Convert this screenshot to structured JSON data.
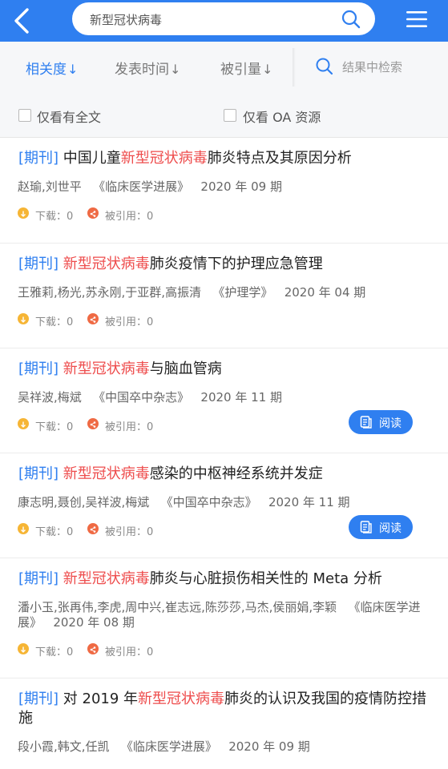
{
  "header": {
    "search_query": "新型冠状病毒"
  },
  "sort": {
    "relevance": "相关度",
    "date": "发表时间",
    "cited": "被引量",
    "arrow": "↓",
    "in_results_placeholder": "结果中检索"
  },
  "filters": {
    "fulltext_only": "仅看有全文",
    "oa_only": "仅看 OA 资源"
  },
  "colors": {
    "brand": "#2f7ff0",
    "highlight": "#ee4c4c"
  },
  "common": {
    "download_label": "下载：",
    "cited_label": "被引用：",
    "read_label": "阅读"
  },
  "results": [
    {
      "tag": "[期刊]",
      "pre": " 中国儿童",
      "hl": "新型冠状病毒",
      "post": "肺炎特点及其原因分析",
      "authors": "赵瑜,刘世平",
      "journal": "《临床医学进展》",
      "issue": "2020 年 09 期",
      "downloads": "0",
      "cited": "0",
      "readable": false
    },
    {
      "tag": "[期刊]",
      "pre": " ",
      "hl": "新型冠状病毒",
      "post": "肺炎疫情下的护理应急管理",
      "authors": "王雅莉,杨光,苏永刚,于亚群,高振清",
      "journal": "《护理学》",
      "issue": "2020 年 04 期",
      "downloads": "0",
      "cited": "0",
      "readable": false
    },
    {
      "tag": "[期刊]",
      "pre": " ",
      "hl": "新型冠状病毒",
      "post": "与脑血管病",
      "authors": "吴祥波,梅斌",
      "journal": "《中国卒中杂志》",
      "issue": "2020 年 11 期",
      "downloads": "0",
      "cited": "0",
      "readable": true
    },
    {
      "tag": "[期刊]",
      "pre": " ",
      "hl": "新型冠状病毒",
      "post": "感染的中枢神经系统并发症",
      "authors": "康志明,聂创,吴祥波,梅斌",
      "journal": "《中国卒中杂志》",
      "issue": "2020 年 11 期",
      "downloads": "0",
      "cited": "0",
      "readable": true
    },
    {
      "tag": "[期刊]",
      "pre": " ",
      "hl": "新型冠状病毒",
      "post": "肺炎与心脏损伤相关性的 Meta 分析",
      "authors": "潘小玉,张再伟,李虎,周中兴,崔志远,陈莎莎,马杰,侯丽娟,李颖",
      "journal": "《临床医学进展》",
      "issue": "2020 年 08 期",
      "downloads": "0",
      "cited": "0",
      "readable": false
    },
    {
      "tag": "[期刊]",
      "pre": " 对 2019 年",
      "hl": "新型冠状病毒",
      "post": "肺炎的认识及我国的疫情防控措施",
      "authors": "段小霞,韩文,任凯",
      "journal": "《临床医学进展》",
      "issue": "2020 年 09 期",
      "downloads": "",
      "cited": "",
      "readable": false
    }
  ]
}
